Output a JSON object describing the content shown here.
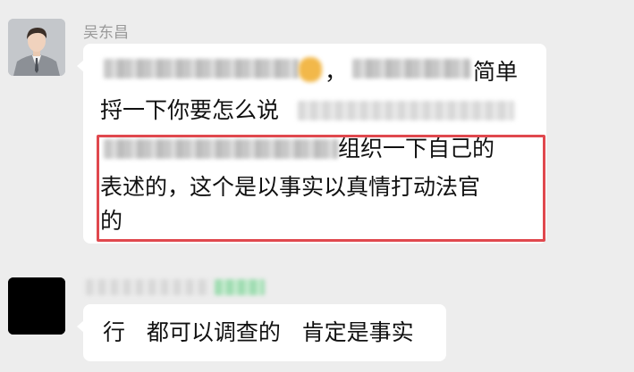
{
  "chat": {
    "message1": {
      "sender": "吴东昌",
      "avatar_icon": "person-portrait-icon",
      "line1_visible": "，",
      "line1_tail": "简单",
      "line2_visible": "捋一下你要怎么说",
      "line3_visible": "组织一下自己的",
      "line4": "表述的，这个是以事实以真情打动法官",
      "line5": "的"
    },
    "message2": {
      "avatar_icon": "black-avatar-icon",
      "text": "行   都可以调查的   肯定是事实"
    },
    "highlight_color": "#e0484e",
    "background_color": "#ededed",
    "bubble_color": "#ffffff"
  }
}
